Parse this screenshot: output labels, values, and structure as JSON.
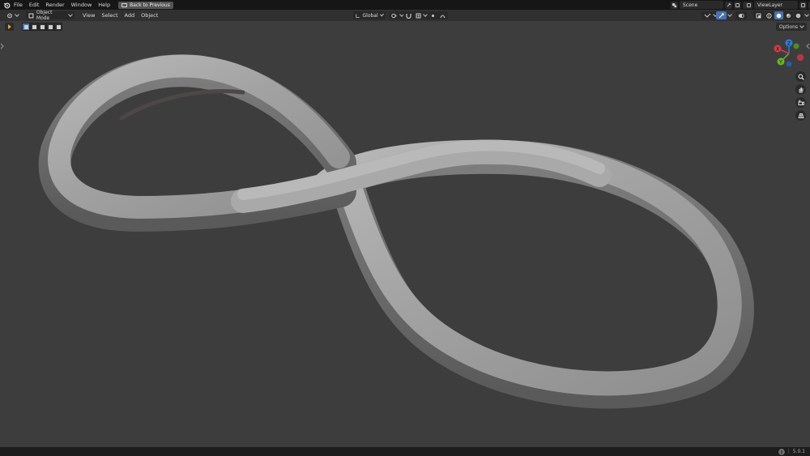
{
  "menubar": {
    "items": [
      "File",
      "Edit",
      "Render",
      "Window",
      "Help"
    ],
    "back_button": "Back to Previous",
    "scene_name": "Scene",
    "view_layer": "ViewLayer"
  },
  "header": {
    "mode": "Object Mode",
    "menus": [
      "View",
      "Select",
      "Add",
      "Object"
    ],
    "orientation": "Global"
  },
  "toolrow": {
    "options_label": "Options"
  },
  "gizmo": {
    "axes": [
      {
        "label": "Z",
        "color": "#2f7bd6"
      },
      {
        "label": "X",
        "color": "#d63b47"
      },
      {
        "label": "Y",
        "color": "#6bb32a"
      }
    ]
  },
  "nav_icons": [
    "zoom-icon",
    "pan-hand-icon",
    "camera-icon",
    "grid-view-icon"
  ],
  "statusbar": {
    "version": "5.0.1"
  },
  "colors": {
    "viewport_bg": "#3d3d3d",
    "accent": "#4772b3",
    "active_tool": "#e8a33a"
  }
}
